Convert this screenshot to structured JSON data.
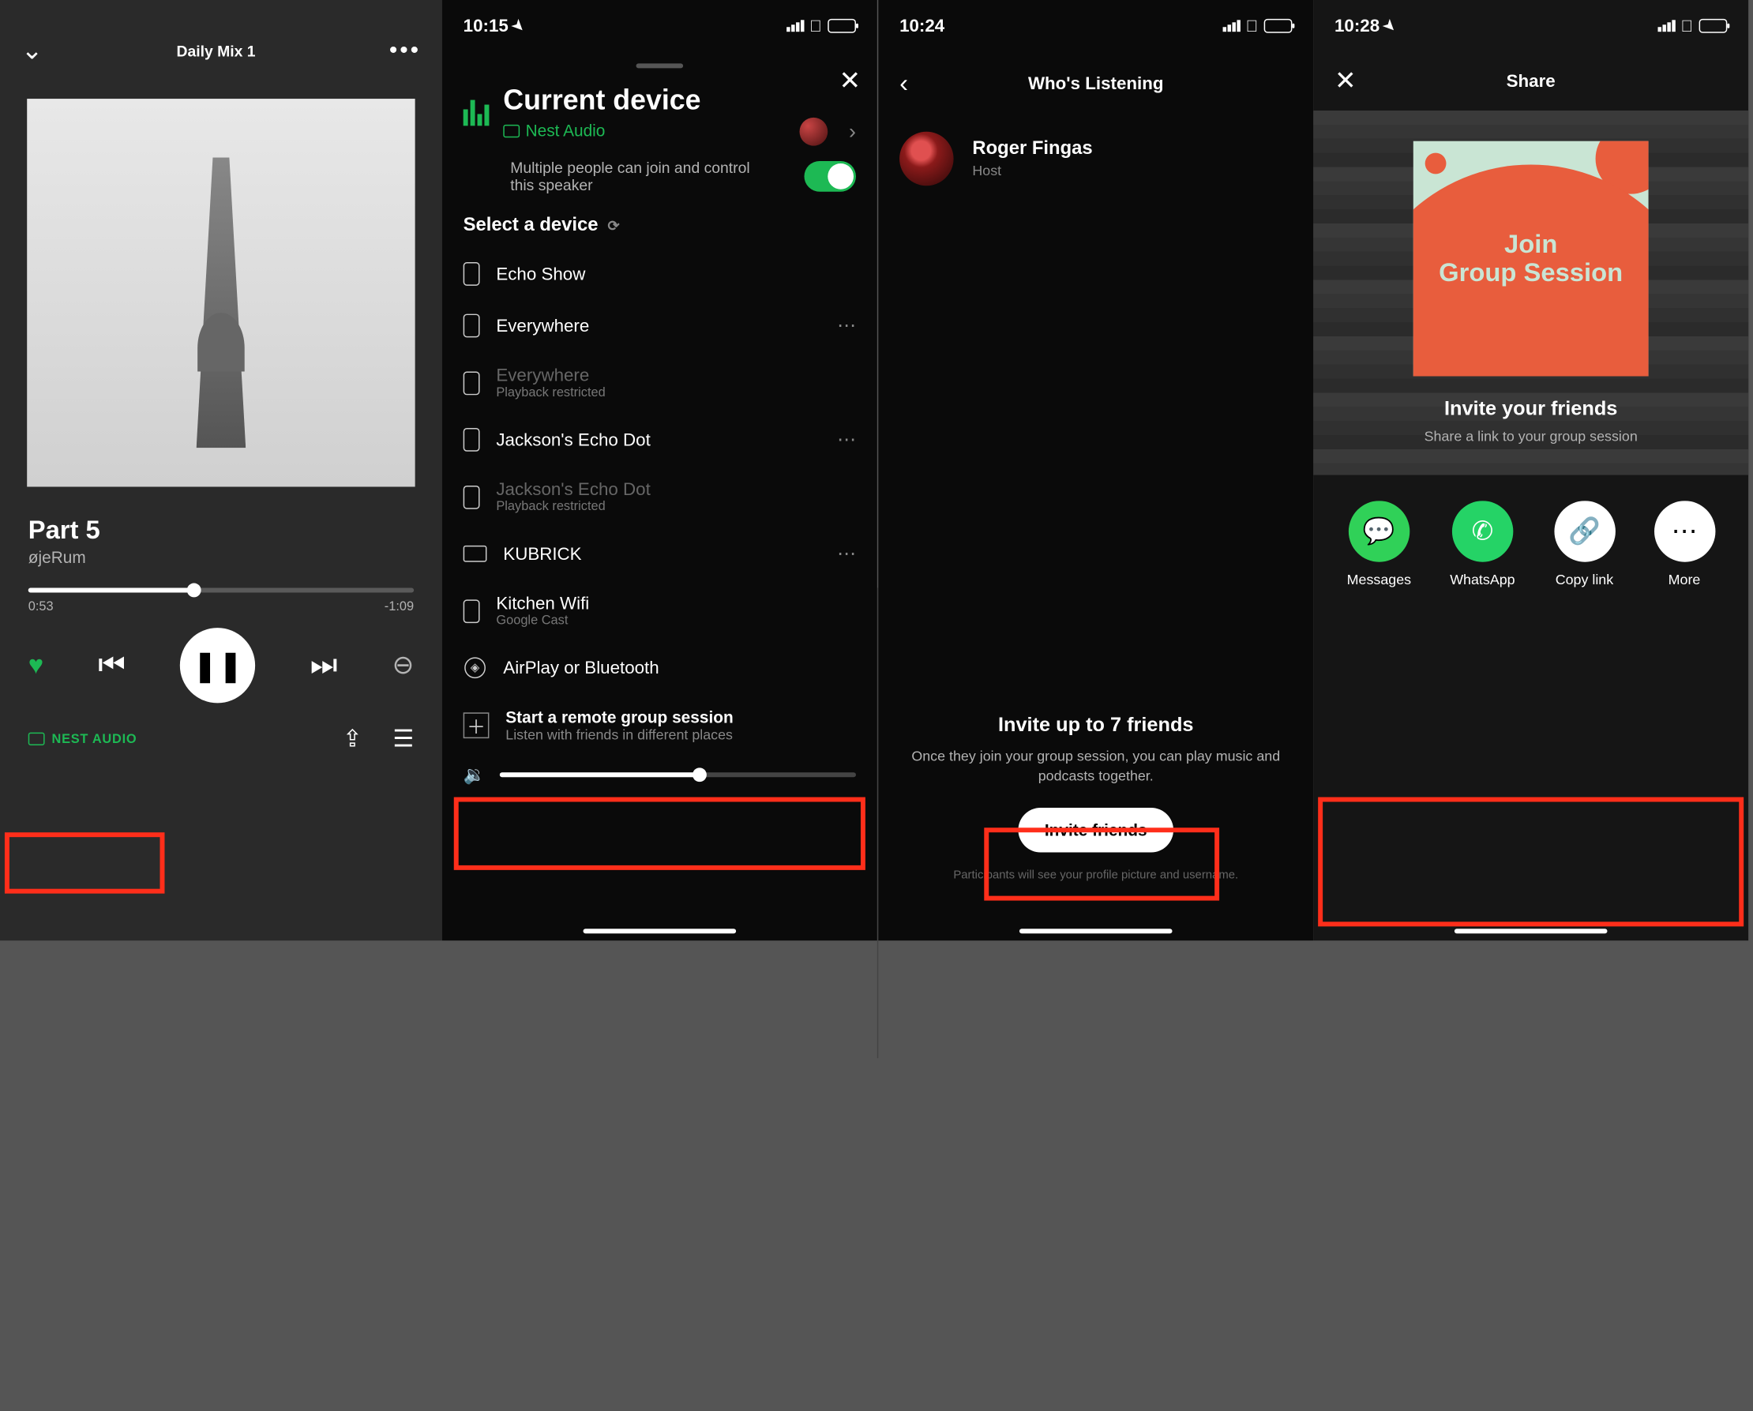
{
  "panel1": {
    "header_title": "Daily Mix 1",
    "track_title": "Part 5",
    "track_artist": "øjeRum",
    "time_elapsed": "0:53",
    "time_remaining": "-1:09",
    "cast_device": "NEST AUDIO"
  },
  "panel2": {
    "status_time": "10:15",
    "current_device_heading": "Current device",
    "current_device_name": "Nest Audio",
    "multi_text": "Multiple people can join and control this speaker",
    "select_header": "Select a device",
    "devices": [
      {
        "name": "Echo Show",
        "sub": "",
        "disabled": false,
        "icon": "speaker",
        "dots": false
      },
      {
        "name": "Everywhere",
        "sub": "",
        "disabled": false,
        "icon": "speaker",
        "dots": true
      },
      {
        "name": "Everywhere",
        "sub": "Playback restricted",
        "disabled": true,
        "icon": "speaker",
        "dots": false
      },
      {
        "name": "Jackson's Echo Dot",
        "sub": "",
        "disabled": false,
        "icon": "speaker",
        "dots": true
      },
      {
        "name": "Jackson's Echo Dot",
        "sub": "Playback restricted",
        "disabled": true,
        "icon": "speaker",
        "dots": false
      },
      {
        "name": "KUBRICK",
        "sub": "",
        "disabled": false,
        "icon": "laptop",
        "dots": true
      },
      {
        "name": "Kitchen Wifi",
        "sub": "Google Cast",
        "disabled": false,
        "icon": "speaker",
        "dots": false
      },
      {
        "name": "AirPlay or Bluetooth",
        "sub": "",
        "disabled": false,
        "icon": "airplay",
        "dots": false
      }
    ],
    "group_session_title": "Start a remote group session",
    "group_session_sub": "Listen with friends in different places"
  },
  "panel3": {
    "status_time": "10:24",
    "title": "Who's Listening",
    "listener_name": "Roger Fingas",
    "listener_role": "Host",
    "invite_heading": "Invite up to 7 friends",
    "invite_body": "Once they join your group session, you can play music and podcasts together.",
    "invite_button": "Invite friends",
    "footer": "Participants will see your profile picture and username."
  },
  "panel4": {
    "status_time": "10:28",
    "title": "Share",
    "card_line1": "Join",
    "card_line2": "Group Session",
    "heading": "Invite your friends",
    "sub": "Share a link to your group session",
    "options": [
      {
        "label": "Messages",
        "class": "ic-messages",
        "glyph": "💬"
      },
      {
        "label": "WhatsApp",
        "class": "ic-whatsapp",
        "glyph": "✆"
      },
      {
        "label": "Copy link",
        "class": "ic-link",
        "glyph": "🔗"
      },
      {
        "label": "More",
        "class": "ic-more",
        "glyph": "⋯"
      }
    ]
  }
}
